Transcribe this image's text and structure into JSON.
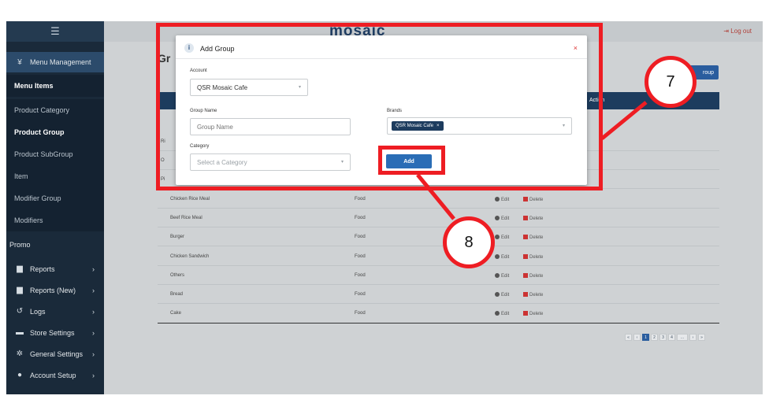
{
  "app": {
    "logo": "mosaic",
    "logout": "Log out"
  },
  "sidebar": {
    "top_icon": "hamburger-icon",
    "menu_management": "Menu Management",
    "menu_items": "Menu Items",
    "product_category": "Product Category",
    "product_group": "Product Group",
    "product_subgroup": "Product SubGroup",
    "item": "Item",
    "modifier_group": "Modifier Group",
    "modifiers": "Modifiers",
    "promo": "Promo",
    "reports": "Reports",
    "reports_new": "Reports (New)",
    "logs": "Logs",
    "store_settings": "Store Settings",
    "general_settings": "General Settings",
    "account_setup": "Account Setup"
  },
  "page": {
    "title_partial": "Gr",
    "add_group_partial": "roup",
    "table_header_action": "Action",
    "rows_partial": [
      "Ri",
      "O",
      "Pi"
    ],
    "rows": [
      {
        "name": "Chicken Rice Meal",
        "category": "Food",
        "edit": "Edit",
        "delete": "Delete"
      },
      {
        "name": "Beef Rice Meal",
        "category": "Food",
        "edit": "Edit",
        "delete": "Delete"
      },
      {
        "name": "Burger",
        "category": "Food",
        "edit": "Edit",
        "delete": "Delete"
      },
      {
        "name": "Chicken Sandwich",
        "category": "Food",
        "edit": "Edit",
        "delete": "Delete"
      },
      {
        "name": "Others",
        "category": "Food",
        "edit": "Edit",
        "delete": "Delete"
      },
      {
        "name": "Bread",
        "category": "Food",
        "edit": "Edit",
        "delete": "Delete"
      },
      {
        "name": "Cake",
        "category": "Food",
        "edit": "Edit",
        "delete": "Delete"
      }
    ],
    "pagination": [
      "«",
      "‹",
      "1",
      "2",
      "3",
      "4",
      "...",
      "›",
      "»"
    ],
    "current_page": "1"
  },
  "modal": {
    "title": "Add Group",
    "close": "×",
    "account_label": "Account",
    "account_value": "QSR Mosaic Cafe",
    "group_name_label": "Group Name",
    "group_name_placeholder": "Group Name",
    "brands_label": "Brands",
    "brand_tag": "QSR Mosaic Cafe",
    "category_label": "Category",
    "category_placeholder": "Select a Category",
    "add_button": "Add"
  },
  "annotations": {
    "callout_7": "7",
    "callout_8": "8",
    "highlight_color": "#ee1d23"
  }
}
